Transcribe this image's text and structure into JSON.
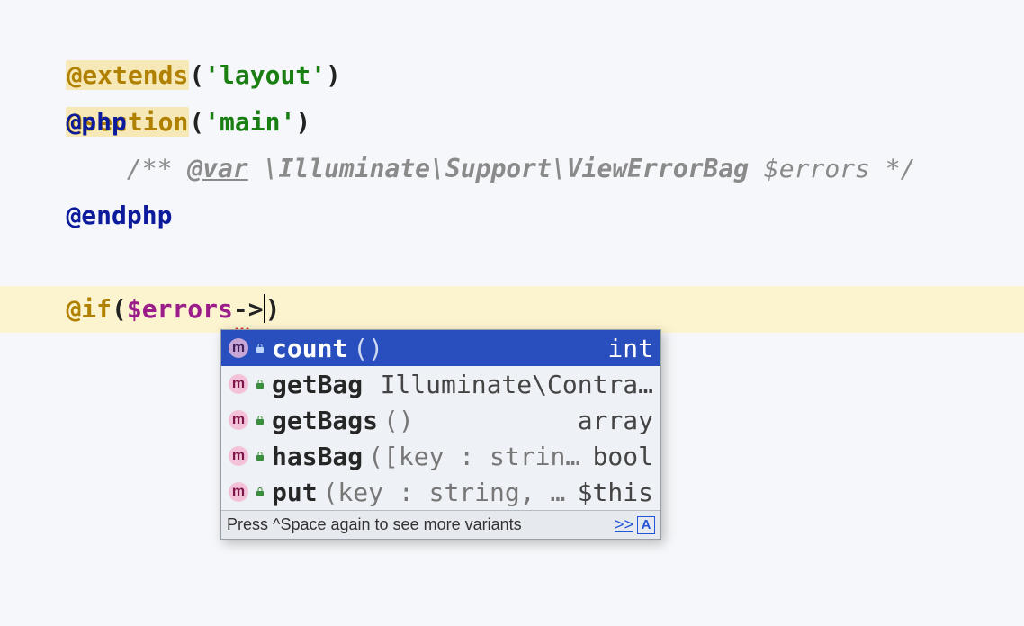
{
  "code": {
    "l1": {
      "dir": "@extends",
      "arg": "'layout'"
    },
    "l2": {
      "dir": "@section",
      "arg": "'main'"
    },
    "l3": {
      "dir": "@php"
    },
    "l4": {
      "open": "/** ",
      "tag": "@var",
      "type": " \\Illuminate\\Support\\ViewErrorBag ",
      "var": "$errors",
      "close": " */"
    },
    "l5": {
      "dir": "@endphp"
    },
    "l7": {
      "dir": "@if",
      "open": "(",
      "var": "$errors",
      "arrow": "->",
      "close": ")"
    }
  },
  "completion": {
    "items": [
      {
        "name": "count",
        "sig": "()",
        "ret": "int",
        "selected": true,
        "iconStyle": "purple"
      },
      {
        "name": "getBag",
        "sig": "",
        "ret": "Illuminate\\Contra…",
        "selected": false,
        "iconStyle": "pink"
      },
      {
        "name": "getBags",
        "sig": "()",
        "ret": "array",
        "selected": false,
        "iconStyle": "pink"
      },
      {
        "name": "hasBag",
        "sig": "([key : strin…",
        "ret": "bool",
        "selected": false,
        "iconStyle": "pink"
      },
      {
        "name": "put",
        "sig": "(key : string, …",
        "ret": "$this",
        "selected": false,
        "iconStyle": "pink"
      }
    ],
    "footer": {
      "hint": "Press ^Space again to see more variants",
      "more": ">>",
      "badge": "A"
    },
    "iconLetter": "m"
  }
}
